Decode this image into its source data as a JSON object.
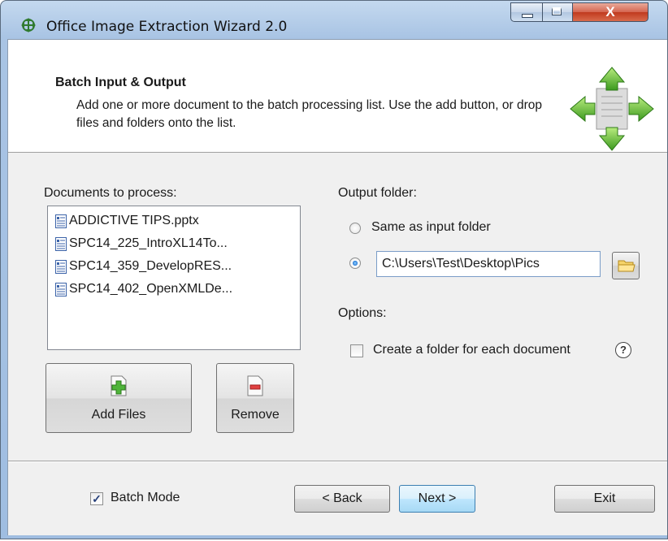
{
  "window": {
    "title": "Office Image Extraction Wizard 2.0",
    "close_glyph": "X"
  },
  "header": {
    "title": "Batch Input & Output",
    "description": "Add one or more document to the batch processing list. Use the add button, or drop files and folders onto the list.",
    "icon": "move-arrows-icon"
  },
  "documents": {
    "label": "Documents to process:",
    "items": [
      {
        "name": "ADDICTIVE TIPS.pptx"
      },
      {
        "name": "SPC14_225_IntroXL14To..."
      },
      {
        "name": "SPC14_359_DevelopRES..."
      },
      {
        "name": "SPC14_402_OpenXMLDe..."
      }
    ],
    "add_label": "Add Files",
    "remove_label": "Remove"
  },
  "output": {
    "label": "Output folder:",
    "same_as_input_label": "Same as input folder",
    "same_as_input_selected": false,
    "custom_selected": true,
    "path": "C:\\Users\\Test\\Desktop\\Pics"
  },
  "options": {
    "label": "Options:",
    "create_folder_label": "Create a folder for each document",
    "create_folder_checked": false,
    "help_glyph": "?"
  },
  "footer": {
    "batch_mode_label": "Batch Mode",
    "batch_mode_checked": true,
    "check_glyph": "✓",
    "back_label": "< Back",
    "next_label": "Next >",
    "exit_label": "Exit"
  }
}
